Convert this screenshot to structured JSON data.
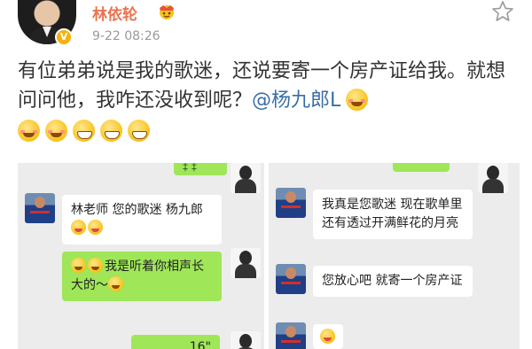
{
  "header": {
    "username": "林依轮",
    "timestamp": "9-22 08:26",
    "verified_badge": "V"
  },
  "post": {
    "text": "有位弟弟说是我的歌迷，还说要寄一个房产证给我。就想问问他，我咋还没收到呢？",
    "mention": "@杨九郎L"
  },
  "screenshots": {
    "left": {
      "top_green_fragment": "‡ ‡",
      "messages": [
        {
          "side": "left",
          "text": "林老师 您的歌迷 杨九郎"
        },
        {
          "side": "right",
          "text": "我是听着你相声长大的～"
        },
        {
          "side": "right",
          "text": "16\""
        }
      ]
    },
    "right": {
      "messages": [
        {
          "side": "left",
          "text": "我真是您歌迷 现在歌单里还有透过开满鲜花的月亮"
        },
        {
          "side": "left",
          "text": "您放心吧 就寄一个房产证"
        }
      ]
    }
  },
  "icons": {
    "avatar": "avatar",
    "verified": "verified-badge-icon",
    "crown": "crown-icon",
    "star": "star-icon",
    "emoji": "emoji-icon"
  },
  "colors": {
    "name": "#eb7350",
    "mention": "#3b6ea8",
    "chat_green": "#9fe658",
    "chat_bg": "#ececec"
  }
}
